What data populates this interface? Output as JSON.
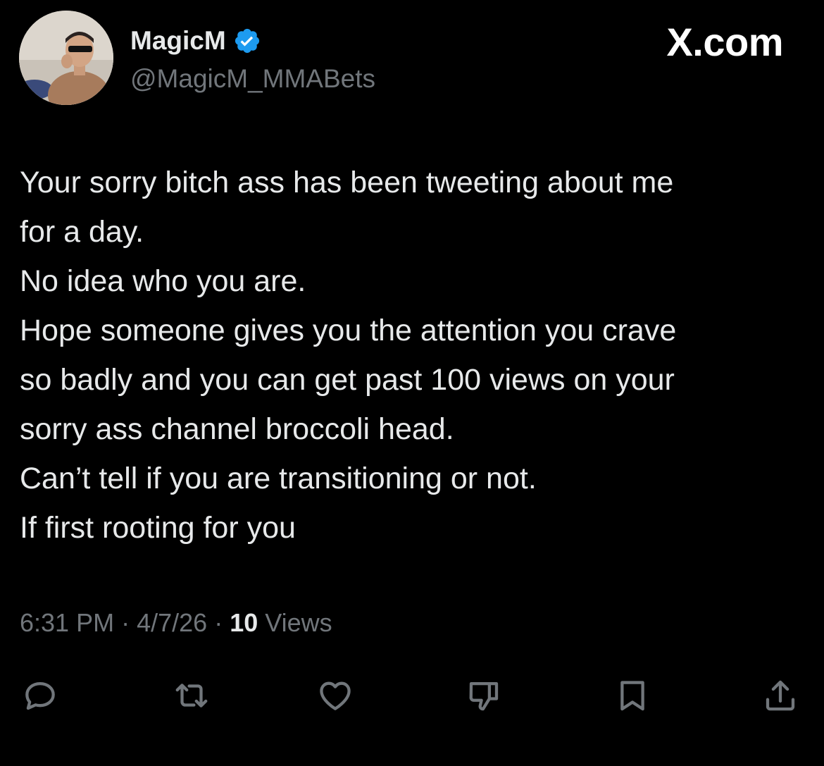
{
  "author": {
    "display_name": "MagicM",
    "handle": "@MagicM_MMABets",
    "verified": true,
    "avatar_icon": "profile-photo"
  },
  "brand": "X.com",
  "tweet": {
    "lines": [
      "Your sorry bitch ass has been tweeting about me",
      "for a day.",
      "No idea who you are.",
      "Hope someone gives you the attention you crave",
      "so badly and you can get past 100 views on your",
      "sorry ass channel broccoli head.",
      "Can’t tell if you are transitioning or not.",
      "If first rooting for you"
    ]
  },
  "meta": {
    "time": "6:31 PM",
    "separator": "·",
    "date": "4/7/26",
    "views_count": "10",
    "views_label": "Views"
  },
  "actions": {
    "icons": [
      "reply-icon",
      "retweet-icon",
      "like-icon",
      "dislike-icon",
      "bookmark-icon",
      "share-icon"
    ]
  },
  "colors": {
    "background": "#000000",
    "text": "#e7e9ea",
    "secondary": "#71767b",
    "verified": "#1d9bf0"
  }
}
